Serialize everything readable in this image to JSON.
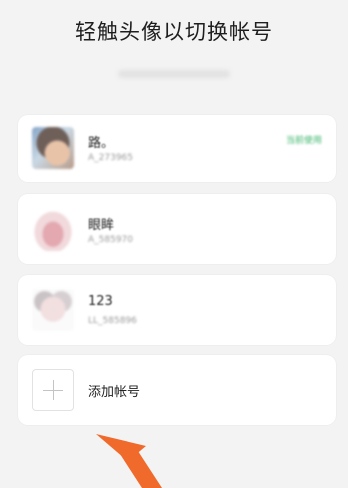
{
  "header": {
    "title": "轻触头像以切换帐号"
  },
  "accounts": [
    {
      "name": "路。",
      "wxid": "A_273965",
      "status": "当前使用"
    },
    {
      "name": "眼眸",
      "wxid": "A_585970",
      "status": ""
    },
    {
      "name": "123",
      "wxid": "LL_585896",
      "status": ""
    }
  ],
  "add_account": {
    "label": "添加帐号"
  },
  "colors": {
    "background": "#f3f3f3",
    "card": "#ffffff",
    "status_green": "#3bb56b",
    "arrow_orange": "#f06a2b"
  }
}
